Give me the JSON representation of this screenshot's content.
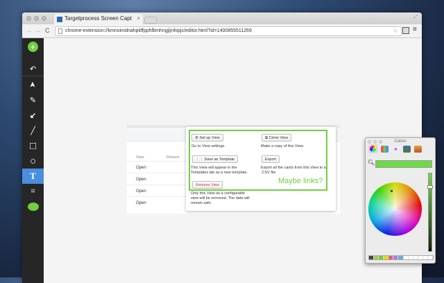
{
  "browser": {
    "tab_title": "Targetprocess Screen Capt",
    "url": "chrome-extension://kmnoimdnahpkffpphfbmhngjijnfopjc/editor.html?id=1400855511269"
  },
  "tools": [
    {
      "name": "add",
      "glyph": "+"
    },
    {
      "name": "undo",
      "glyph": "↶"
    },
    {
      "name": "select",
      "glyph": "➤"
    },
    {
      "name": "pencil",
      "glyph": "✎"
    },
    {
      "name": "arrow",
      "glyph": "↙"
    },
    {
      "name": "line",
      "glyph": "╱"
    },
    {
      "name": "rectangle",
      "glyph": "□"
    },
    {
      "name": "ellipse",
      "glyph": "○"
    },
    {
      "name": "text",
      "glyph": "T"
    },
    {
      "name": "crop",
      "glyph": "⌗"
    },
    {
      "name": "color",
      "glyph": ""
    }
  ],
  "active_color": "#6fcf3e",
  "table": {
    "headers": [
      "State",
      "Release"
    ],
    "rows": [
      "Open",
      "Open",
      "Open",
      "Open"
    ]
  },
  "popup": {
    "setup_label": "Set up View",
    "setup_desc": "Go to View settings.",
    "clone_label": "Clone View",
    "clone_desc": "Make a copy of this View.",
    "template_label": "Save as Template",
    "template_desc": "This View will appear in the Templates tab as a new template.",
    "export_label": "Export",
    "export_desc": "Export all the cards from this View to a .CSV file",
    "remove_label": "Remove View",
    "remove_desc": "Only this View as a configurable view will be removed. The data will remain safe.",
    "annotation": "Maybe links?"
  },
  "colors_panel": {
    "title": "Colors",
    "selected_color": "#6fd94a",
    "favorites": [
      "#444444",
      "#a8c850",
      "#6fcf3e",
      "#e8d800",
      "#e06080",
      "#b080d0",
      "#70a8e0"
    ]
  }
}
